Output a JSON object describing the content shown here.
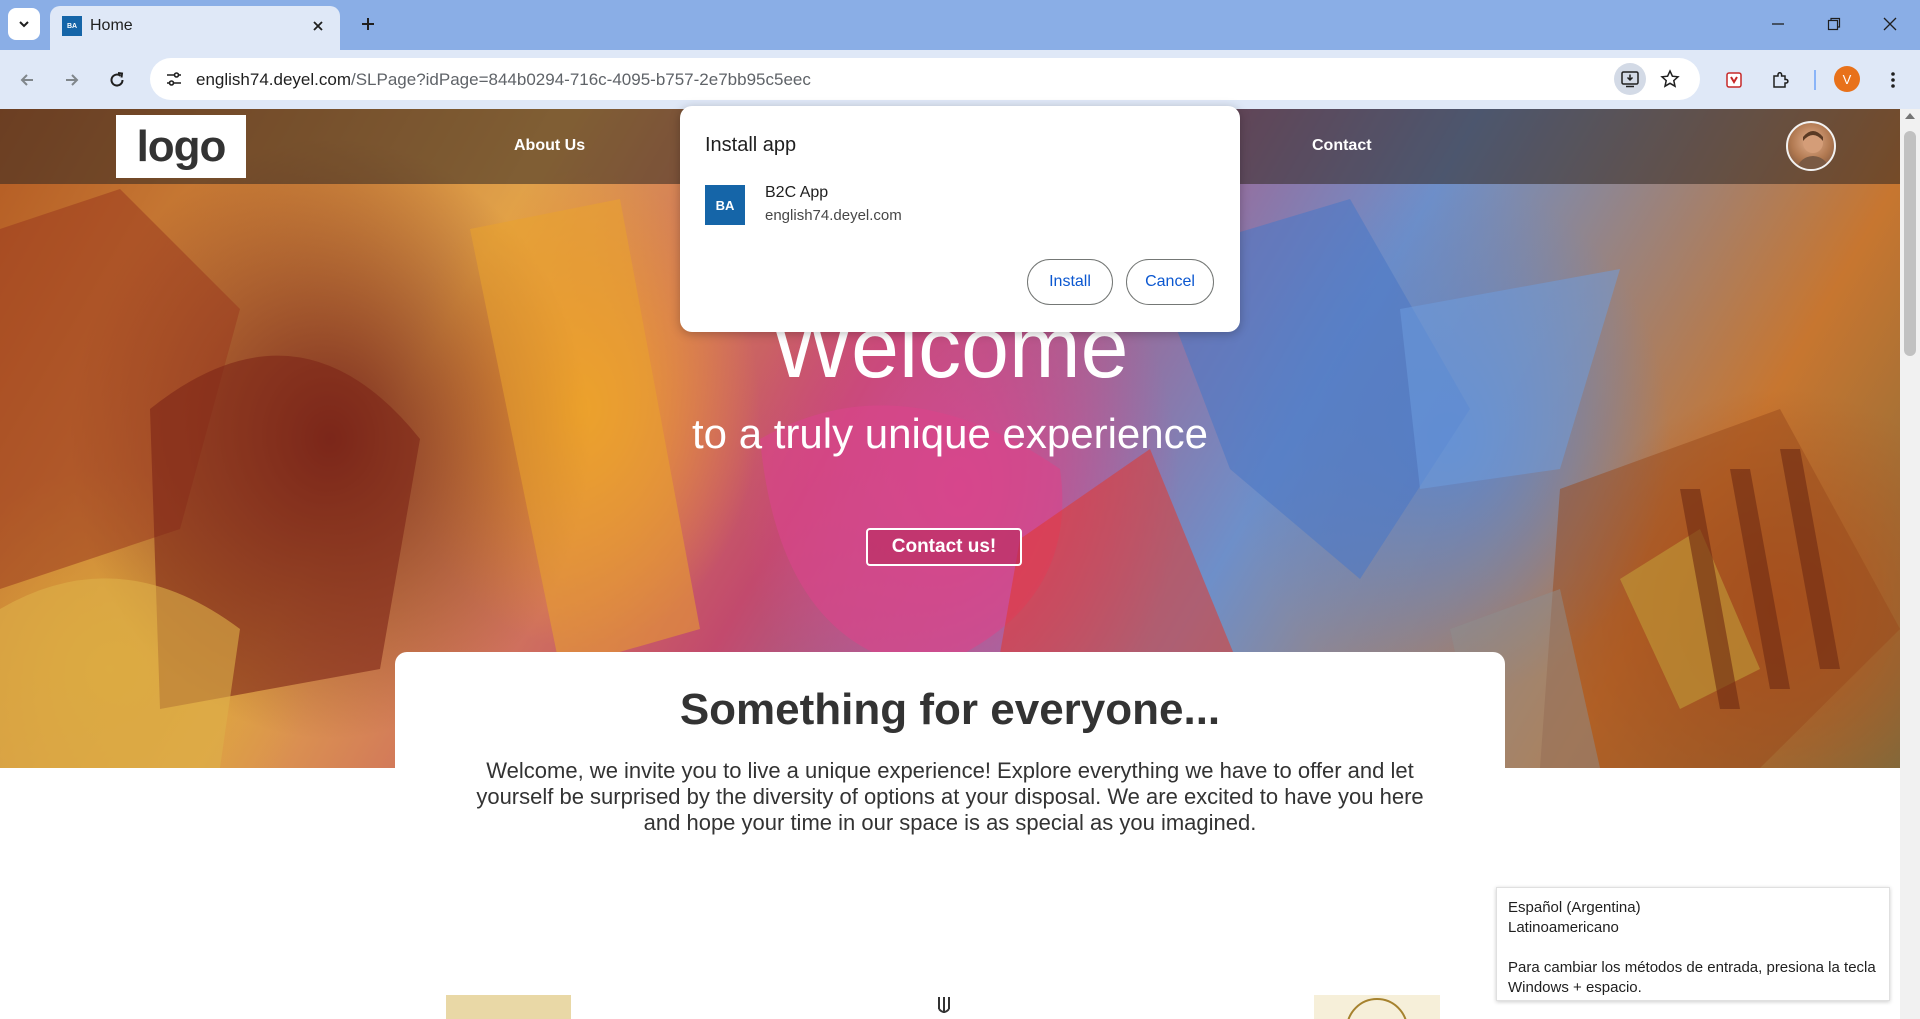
{
  "browser": {
    "tab": {
      "favicon_text": "BA",
      "title": "Home"
    },
    "url": {
      "host": "english74.deyel.com",
      "path": "/SLPage?idPage=844b0294-716c-4095-b757-2e7bb95c5eec"
    },
    "profile_initial": "V"
  },
  "site": {
    "logo": "logo",
    "nav": {
      "about": "About Us",
      "contact": "Contact"
    },
    "hero": {
      "title": "Welcome",
      "subtitle": "to a truly unique experience",
      "cta": "Contact us!"
    },
    "intro": {
      "title": "Something for everyone...",
      "text": "Welcome, we invite you to live a unique experience! Explore everything we have to offer and let yourself be surprised by the diversity of options at your disposal. We are excited to have you here and hope your time in our space is as special as you imagined."
    }
  },
  "install_dialog": {
    "title": "Install app",
    "app_icon_text": "BA",
    "app_name": "B2C App",
    "app_origin": "english74.deyel.com",
    "install_label": "Install",
    "cancel_label": "Cancel"
  },
  "ime_popup": {
    "language": "Español (Argentina)",
    "layout": "Latinoamericano",
    "hint": "Para cambiar los métodos de entrada, presiona la tecla Windows + espacio."
  },
  "colors": {
    "tabstrip": "#8aaee6",
    "toolbar": "#dfe8f7",
    "accent": "#0b57d0",
    "app_icon": "#1565a8",
    "profile": "#e8711a"
  }
}
